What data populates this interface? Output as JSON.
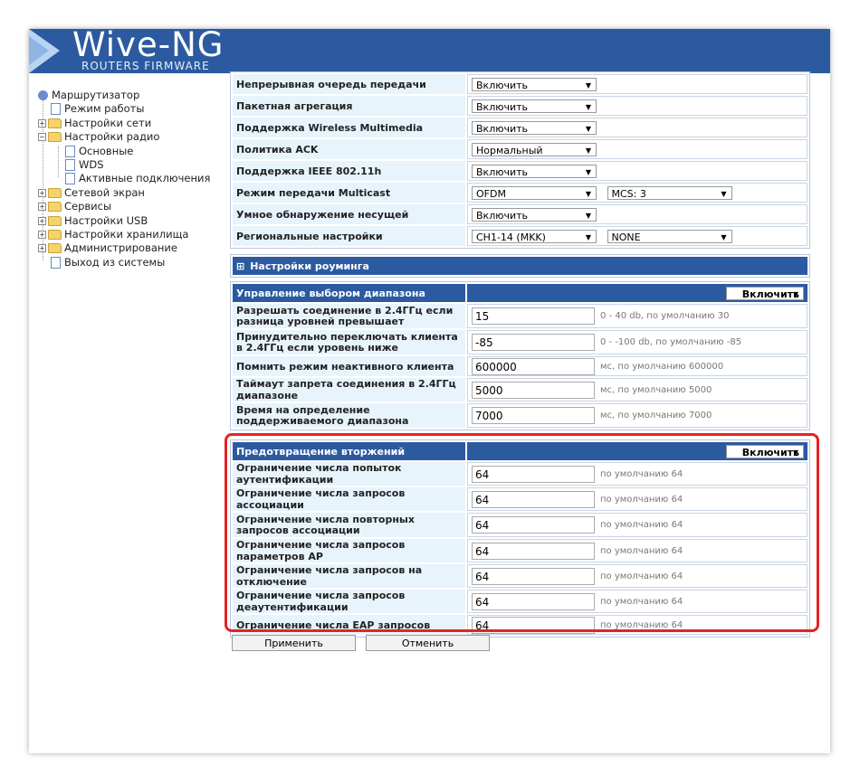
{
  "header": {
    "logo_title": "Wive-NG",
    "logo_subtitle": "ROUTERS FIRMWARE"
  },
  "tree": [
    {
      "label": "Маршрутизатор"
    },
    {
      "label": "Режим работы"
    },
    {
      "label": "Настройки сети"
    },
    {
      "label": "Настройки радио"
    },
    {
      "label": "Основные"
    },
    {
      "label": "WDS"
    },
    {
      "label": "Активные подключения"
    },
    {
      "label": "Сетевой экран"
    },
    {
      "label": "Сервисы"
    },
    {
      "label": "Настройки USB"
    },
    {
      "label": "Настройки хранилища"
    },
    {
      "label": "Администрирование"
    },
    {
      "label": "Выход из системы"
    }
  ],
  "radio": [
    {
      "label": "Непрерывная очередь передачи",
      "value": "Включить"
    },
    {
      "label": "Пакетная агрегация",
      "value": "Включить"
    },
    {
      "label": "Поддержка Wireless Multimedia",
      "value": "Включить"
    },
    {
      "label": "Политика ACK",
      "value": "Нормальный"
    },
    {
      "label": "Поддержка IEEE 802.11h",
      "value": "Включить"
    },
    {
      "label": "Режим передачи Multicast",
      "value": "OFDM",
      "value2": "MCS: 3"
    },
    {
      "label": "Умное обнаружение несущей",
      "value": "Включить"
    },
    {
      "label": "Региональные настройки",
      "value": "CH1-14 (MKK)",
      "value2": "NONE"
    }
  ],
  "roaming": {
    "expand_glyph": "⊞",
    "title": "Настройки роуминга"
  },
  "band": {
    "title": "Управление выбором диапазона",
    "toggle": "Включить",
    "rows": [
      {
        "label": "Разрешать соединение в 2.4ГГц если разница уровней превышает",
        "value": "15",
        "hint": "0 - 40 db, по умолчанию 30"
      },
      {
        "label": "Принудительно переключать клиента в 2.4ГГц если уровень ниже",
        "value": "-85",
        "hint": "0 - -100 db, по умолчанию -85"
      },
      {
        "label": "Помнить режим неактивного клиента",
        "value": "600000",
        "hint": "мс, по умолчанию 600000"
      },
      {
        "label": "Таймаут запрета соединения в 2.4ГГц диапазоне",
        "value": "5000",
        "hint": "мс, по умолчанию 5000"
      },
      {
        "label": "Время на определение поддерживаемого диапазона",
        "value": "7000",
        "hint": "мс, по умолчанию 7000"
      }
    ]
  },
  "ids": {
    "title": "Предотвращение вторжений",
    "toggle": "Включить",
    "rows": [
      {
        "label": "Ограничение числа попыток аутентификации",
        "value": "64",
        "hint": "по умолчанию 64"
      },
      {
        "label": "Ограничение числа запросов ассоциации",
        "value": "64",
        "hint": "по умолчанию 64"
      },
      {
        "label": "Ограничение числа повторных запросов ассоциации",
        "value": "64",
        "hint": "по умолчанию 64"
      },
      {
        "label": "Ограничение числа запросов параметров AP",
        "value": "64",
        "hint": "по умолчанию 64"
      },
      {
        "label": "Ограничение числа запросов на отключение",
        "value": "64",
        "hint": "по умолчанию 64"
      },
      {
        "label": "Ограничение числа запросов деаутентификации",
        "value": "64",
        "hint": "по умолчанию 64"
      },
      {
        "label": "Ограничение числа EAP запросов",
        "value": "64",
        "hint": "по умолчанию 64"
      }
    ]
  },
  "buttons": {
    "apply": "Применить",
    "cancel": "Отменить"
  },
  "colors": {
    "header": "#2c5aa0",
    "label_bg": "#e8f4fc",
    "highlight": "#e32424"
  }
}
